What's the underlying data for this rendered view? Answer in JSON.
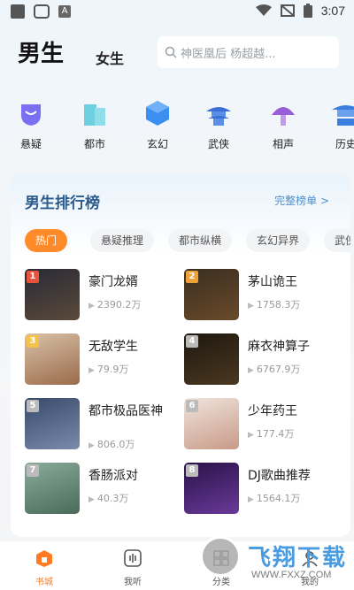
{
  "status_bar": {
    "time": "3:07",
    "app_icon_letter": "A"
  },
  "header": {
    "tab_male": "男生",
    "tab_female": "女生",
    "search_placeholder": "神医凰后  杨超越..."
  },
  "categories": [
    {
      "label": "悬疑",
      "icon": "shield-icon",
      "color": "#7a6ff0"
    },
    {
      "label": "都市",
      "icon": "buildings-icon",
      "color": "#6dcfe0"
    },
    {
      "label": "玄幻",
      "icon": "cube-icon",
      "color": "#3a8ff0"
    },
    {
      "label": "武侠",
      "icon": "pagoda-icon",
      "color": "#3a6fd8"
    },
    {
      "label": "相声",
      "icon": "mushroom-icon",
      "color": "#9a5fd8"
    },
    {
      "label": "历史",
      "icon": "pavilion-icon",
      "color": "#3a7fe0"
    }
  ],
  "ranking": {
    "title": "男生排行榜",
    "more_label": "完整榜单 >",
    "tags": [
      "热门",
      "悬疑推理",
      "都市纵横",
      "玄幻异界",
      "武侠"
    ],
    "items": [
      {
        "rank": "1",
        "title": "豪门龙婿",
        "count": "2390.2万",
        "rank_color": "#e9533c",
        "cover_color": "#3b3b4a"
      },
      {
        "rank": "2",
        "title": "茅山诡王",
        "count": "1758.3万",
        "rank_color": "#f0a23a",
        "cover_color": "#4a3a2a"
      },
      {
        "rank": "3",
        "title": "无敌学生",
        "count": "79.9万",
        "rank_color": "#f4c14a",
        "cover_color": "#c9a98a"
      },
      {
        "rank": "4",
        "title": "麻衣神算子",
        "count": "6767.9万",
        "rank_color": "#bbbbbb",
        "cover_color": "#2e2418"
      },
      {
        "rank": "5",
        "title": "都市极品医神",
        "count": "806.0万",
        "rank_color": "#bbbbbb",
        "cover_color": "#4a5a7a"
      },
      {
        "rank": "6",
        "title": "少年药王",
        "count": "177.4万",
        "rank_color": "#bbbbbb",
        "cover_color": "#e8d8d0"
      },
      {
        "rank": "7",
        "title": "香肠派对",
        "count": "40.3万",
        "rank_color": "#bbbbbb",
        "cover_color": "#6a8a6a"
      },
      {
        "rank": "8",
        "title": "DJ歌曲推荐",
        "count": "1564.1万",
        "rank_color": "#bbbbbb",
        "cover_color": "#3a1f5a"
      }
    ]
  },
  "bottom_nav": [
    {
      "label": "书城",
      "icon": "home-icon",
      "active": true
    },
    {
      "label": "我听",
      "icon": "listen-icon",
      "active": false
    },
    {
      "label": "分类",
      "icon": "category-icon",
      "active": false
    },
    {
      "label": "我的",
      "icon": "profile-icon",
      "active": false
    }
  ],
  "watermark": {
    "text": "飞翔下载",
    "url": "WWW.FXXZ.COM"
  }
}
